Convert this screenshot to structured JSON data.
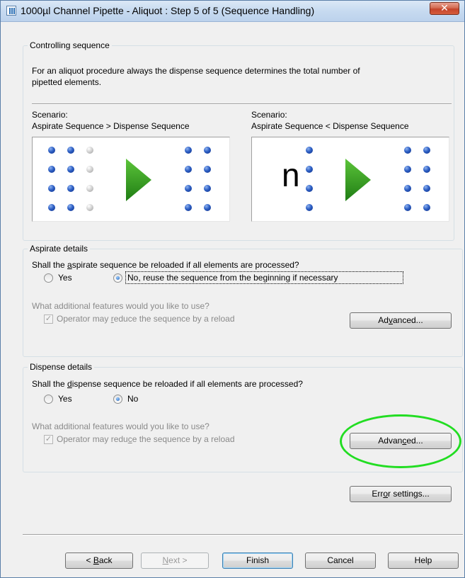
{
  "window": {
    "title": "1000µl Channel Pipette - Aliquot : Step 5 of 5 (Sequence Handling)",
    "close_label": "✕"
  },
  "controlling": {
    "legend": "Controlling sequence",
    "description_line1": "For an aliquot procedure always the dispense sequence determines the total number of",
    "description_line2": "pipetted elements.",
    "scenario1": {
      "label": "Scenario:",
      "caption": "Aspirate Sequence > Dispense Sequence"
    },
    "scenario2": {
      "label": "Scenario:",
      "caption": "Aspirate Sequence < Dispense Sequence",
      "n_label": "n"
    }
  },
  "aspirate": {
    "legend": "Aspirate details",
    "question_pre": "Shall the ",
    "question_key": "a",
    "question_post": "spirate sequence be reloaded if all elements are processed?",
    "yes_label": "Yes",
    "no_label": "No, reuse the sequence from the beginning if necessary",
    "selected": "No, reuse the sequence from the beginning if necessary",
    "features_label": "What additional features would you like to use?",
    "reduce_pre": "Operator may ",
    "reduce_key": "r",
    "reduce_post": "educe the sequence by a reload",
    "reduce_checked": true,
    "advanced_pre": "Ad",
    "advanced_key": "v",
    "advanced_post": "anced..."
  },
  "dispense": {
    "legend": "Dispense details",
    "question_pre": "Shall the ",
    "question_key": "d",
    "question_post": "ispense sequence be reloaded if all elements are processed?",
    "yes_label": "Yes",
    "no_label": "No",
    "selected": "No",
    "features_label": "What additional features would you like to use?",
    "reduce_pre": "Operator may redu",
    "reduce_key": "c",
    "reduce_post": "e the sequence by a reload",
    "reduce_checked": true,
    "advanced_pre": "Advan",
    "advanced_key": "c",
    "advanced_post": "ed..."
  },
  "error_settings": {
    "pre": "Err",
    "key": "o",
    "post": "r settings..."
  },
  "footer": {
    "back_pre": "< ",
    "back_key": "B",
    "back_post": "ack",
    "next_pre": "",
    "next_key": "N",
    "next_post": "ext >",
    "finish": "Finish",
    "cancel": "Cancel",
    "help": "Help"
  },
  "colors": {
    "highlight": "#22dd22",
    "arrow_green": "#2e9a1e",
    "dot_blue": "#1d4fb8"
  }
}
